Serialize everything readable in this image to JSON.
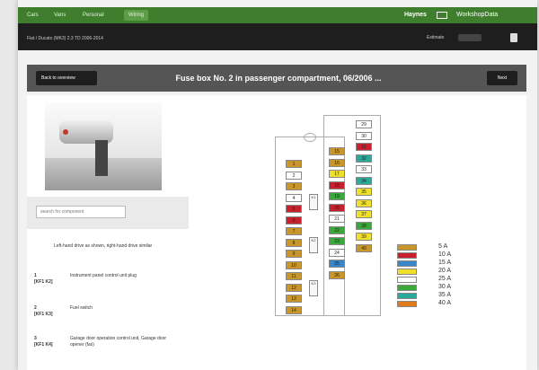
{
  "nav": {
    "tabs": [
      "Cars",
      "Vans",
      "Personal",
      "Wiring"
    ],
    "active_tab": "Wiring",
    "brand_left": "Haynes",
    "brand_right": "WorkshopData"
  },
  "vehicle_line": "Fiat / Ducato (MK3) 2.3 TD 2006-2014",
  "estimate_label": "Estimate",
  "title_bar": {
    "back_label": "Back to overview",
    "title": "Fuse box No. 2 in passenger compartment, 06/2006 ...",
    "next_label": "Next"
  },
  "left": {
    "search_placeholder": "search for component",
    "note": "Left-hand drive as shown, right-hand drive similar",
    "items": [
      {
        "num": "1",
        "code": "[KF1 K2]",
        "desc": "Instrument panel control unit plug"
      },
      {
        "num": "2",
        "code": "[KF1 K3]",
        "desc": "Fuel switch"
      },
      {
        "num": "3",
        "code": "[KF1 K4]",
        "desc": "Garage door operation control unit, Garage door opener (fax)"
      }
    ]
  },
  "colors": {
    "green_bar": "#3e7e2c",
    "dark_bar": "#1e1e1e",
    "title_bar": "#555555",
    "fuse_brown": "#c8962a",
    "fuse_red": "#c8202c",
    "fuse_blue": "#3a86c8",
    "fuse_yellow": "#f0e02a",
    "fuse_white": "#ffffff",
    "fuse_green": "#3aa83a",
    "fuse_orange": "#e07a1a",
    "fuse_teal": "#2aa89a"
  },
  "fuses_left": [
    {
      "n": "1",
      "c": "brown"
    },
    {
      "n": "2",
      "c": "white"
    },
    {
      "n": "3",
      "c": "brown"
    },
    {
      "n": "4",
      "c": "white"
    },
    {
      "n": "5",
      "c": "red"
    },
    {
      "n": "6",
      "c": "red"
    },
    {
      "n": "7",
      "c": "brown"
    },
    {
      "n": "8",
      "c": "brown"
    },
    {
      "n": "9",
      "c": "brown"
    },
    {
      "n": "10",
      "c": "brown"
    },
    {
      "n": "11",
      "c": "brown"
    },
    {
      "n": "12",
      "c": "brown"
    },
    {
      "n": "13",
      "c": "brown"
    },
    {
      "n": "14",
      "c": "brown"
    }
  ],
  "fuses_mid": [
    {
      "n": "15",
      "c": "brown"
    },
    {
      "n": "16",
      "c": "brown"
    },
    {
      "n": "17",
      "c": "yellow"
    },
    {
      "n": "18",
      "c": "red"
    },
    {
      "n": "19",
      "c": "green"
    },
    {
      "n": "20",
      "c": "red"
    },
    {
      "n": "21",
      "c": "white"
    },
    {
      "n": "22",
      "c": "green"
    },
    {
      "n": "23",
      "c": "green"
    },
    {
      "n": "24",
      "c": "white"
    },
    {
      "n": "25",
      "c": "blue"
    },
    {
      "n": "26",
      "c": "brown"
    }
  ],
  "fuses_right": [
    {
      "n": "29",
      "c": "white"
    },
    {
      "n": "30",
      "c": "white"
    },
    {
      "n": "31",
      "c": "red"
    },
    {
      "n": "32",
      "c": "teal"
    },
    {
      "n": "33",
      "c": "white"
    },
    {
      "n": "34",
      "c": "teal"
    },
    {
      "n": "35",
      "c": "yellow"
    },
    {
      "n": "36",
      "c": "yellow"
    },
    {
      "n": "37",
      "c": "yellow"
    },
    {
      "n": "38",
      "c": "green"
    },
    {
      "n": "39",
      "c": "yellow"
    },
    {
      "n": "40",
      "c": "brown"
    }
  ],
  "legend": [
    {
      "label": "5 A",
      "c": "brown"
    },
    {
      "label": "10 A",
      "c": "red"
    },
    {
      "label": "15 A",
      "c": "blue"
    },
    {
      "label": "20 A",
      "c": "yellow"
    },
    {
      "label": "25 A",
      "c": "white"
    },
    {
      "label": "30 A",
      "c": "green"
    },
    {
      "label": "35 A",
      "c": "teal"
    },
    {
      "label": "40 A",
      "c": "orange"
    }
  ],
  "relay_labels": [
    "K1",
    "K2",
    "K3"
  ]
}
